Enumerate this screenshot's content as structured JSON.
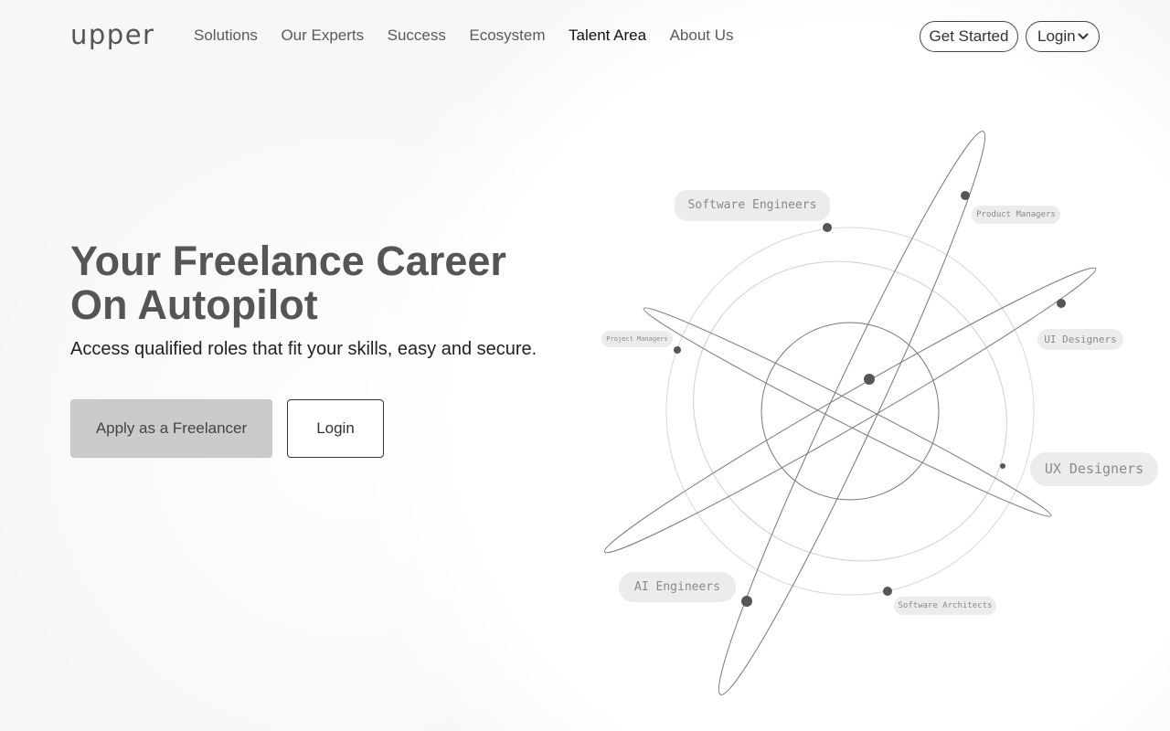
{
  "brand": {
    "logo_text": "upper"
  },
  "nav": {
    "items": [
      {
        "label": "Solutions",
        "active": false
      },
      {
        "label": "Our Experts",
        "active": false
      },
      {
        "label": "Success",
        "active": false
      },
      {
        "label": "Ecosystem",
        "active": false
      },
      {
        "label": "Talent Area",
        "active": true
      },
      {
        "label": "About Us",
        "active": false
      }
    ]
  },
  "header_actions": {
    "get_started_label": "Get Started",
    "login_label": "Login",
    "login_icon": "chevron-down-icon"
  },
  "hero": {
    "title_line1": "Your Freelance Career",
    "title_line2": "On Autopilot",
    "subtitle": "Access qualified roles that fit your skills, easy and secure.",
    "apply_label": "Apply as a Freelancer",
    "login_label": "Login"
  },
  "orbit_tags": {
    "software_engineers": "Software Engineers",
    "product_managers_right": "Product Managers",
    "project_managers": "Project Managers",
    "ui_designers": "UI Designers",
    "ux_designers": "UX Designers",
    "ai_engineers": "AI Engineers",
    "software_architects": "Software Architects"
  },
  "colors": {
    "background": "#f7f7f7",
    "apply_button": "#cbcbcb",
    "text_primary": "#555555",
    "tag_bg": "#ececec"
  }
}
